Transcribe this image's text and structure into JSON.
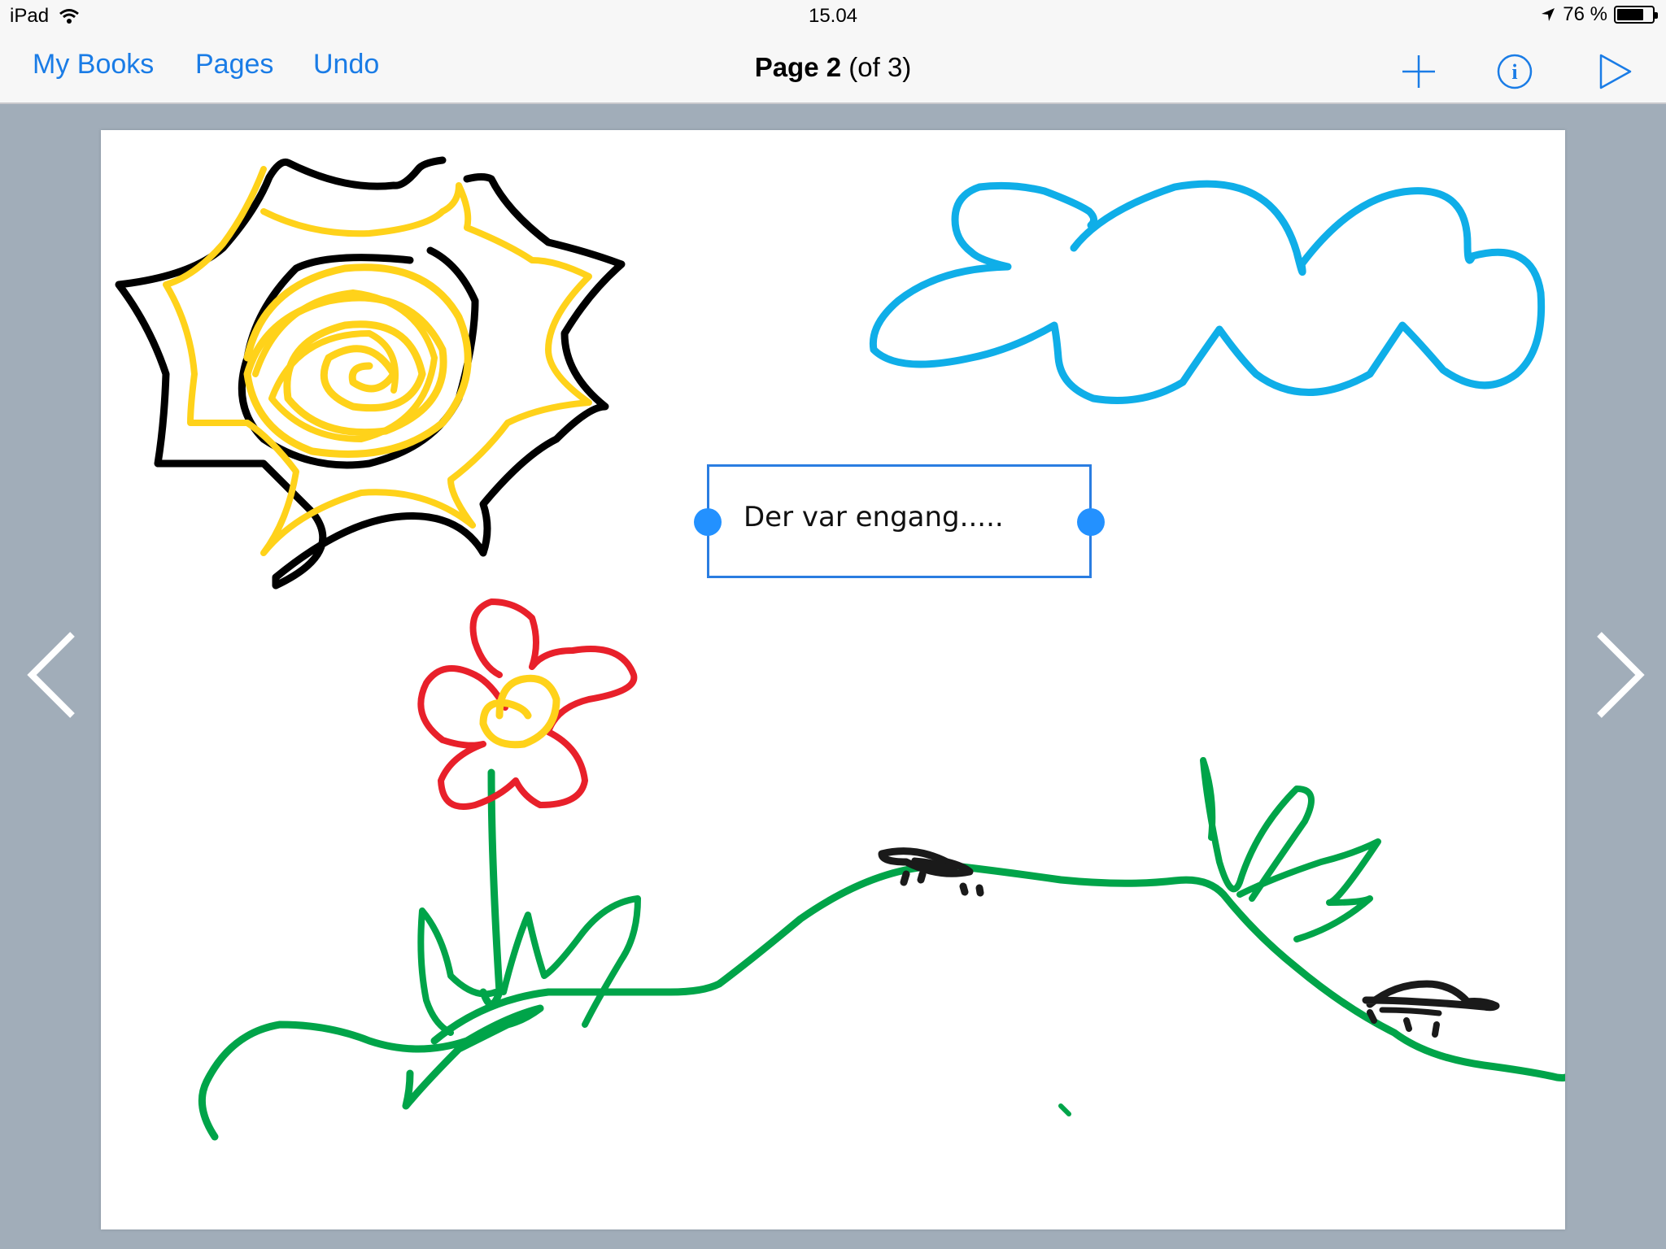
{
  "status_bar": {
    "device": "iPad",
    "time": "15.04",
    "battery_percent": "76 %",
    "battery_level": 0.76,
    "icons": [
      "wifi-icon",
      "location-arrow-icon",
      "battery-icon"
    ]
  },
  "nav": {
    "my_books_label": "My Books",
    "pages_label": "Pages",
    "undo_label": "Undo",
    "title_page": "Page 2",
    "title_of": "(of 3)",
    "accent_color": "#1a7ce6",
    "right_icons": [
      "add-icon",
      "info-icon",
      "play-icon"
    ]
  },
  "canvas": {
    "text_box": "Der var engang.....",
    "colors": {
      "sun_outline": "#000000",
      "sun_fill": "#ffd21a",
      "cloud": "#0faee8",
      "flower_petals": "#e8202a",
      "flower_center": "#ffd21a",
      "grass": "#00a449",
      "bugs": "#1a1a1a",
      "selection": "#2a7de1"
    }
  },
  "navigation_arrows": [
    "chevron-left-icon",
    "chevron-right-icon"
  ]
}
